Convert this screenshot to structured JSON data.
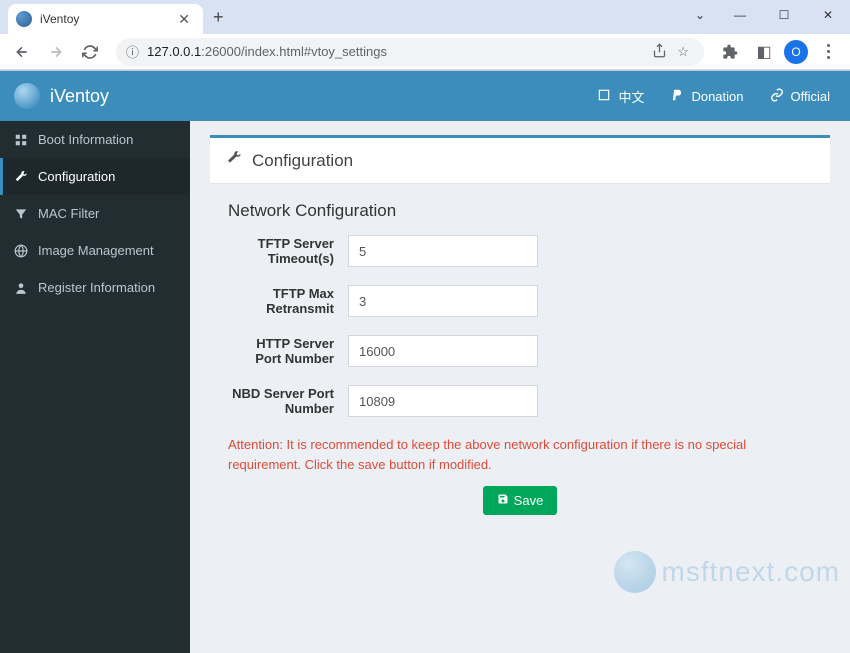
{
  "browser": {
    "tab_title": "iVentoy",
    "url_host": "127.0.0.1",
    "url_port_path": ":26000/index.html#vtoy_settings",
    "profile_letter": "O"
  },
  "topnav": {
    "brand": "iVentoy",
    "lang": "中文",
    "donation": "Donation",
    "official": "Official"
  },
  "sidebar": {
    "items": [
      {
        "label": "Boot Information"
      },
      {
        "label": "Configuration"
      },
      {
        "label": "MAC Filter"
      },
      {
        "label": "Image Management"
      },
      {
        "label": "Register Information"
      }
    ]
  },
  "page": {
    "header": "Configuration",
    "section_title": "Network Configuration",
    "fields": {
      "tftp_timeout": {
        "label": "TFTP Server Timeout(s)",
        "value": "5"
      },
      "tftp_retransmit": {
        "label": "TFTP Max Retransmit",
        "value": "3"
      },
      "http_port": {
        "label": "HTTP Server Port Number",
        "value": "16000"
      },
      "nbd_port": {
        "label": "NBD Server Port Number",
        "value": "10809"
      }
    },
    "attention": "Attention: It is recommended to keep the above network configuration if there is no special requirement. Click the save button if modified.",
    "save_label": "Save"
  },
  "watermark": "msftnext.com"
}
